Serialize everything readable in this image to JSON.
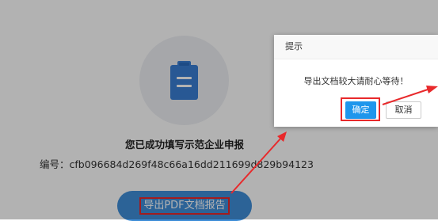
{
  "page": {
    "success_title": "您已成功填写示范企业申报",
    "code_line": "编号：cfb096684d269f48c66a16dd211699d829b94123",
    "export_button": "导出PDF文档报告",
    "icon": "clipboard-icon"
  },
  "dialog": {
    "title": "提示",
    "message": "导出文档较大请耐心等待！",
    "ok_label": "确定",
    "cancel_label": "取消"
  },
  "colors": {
    "primary": "#3f8ed8",
    "dialog_ok": "#1e96ec",
    "highlight": "#e8292b",
    "mask": "rgba(0,0,0,0.30)"
  }
}
